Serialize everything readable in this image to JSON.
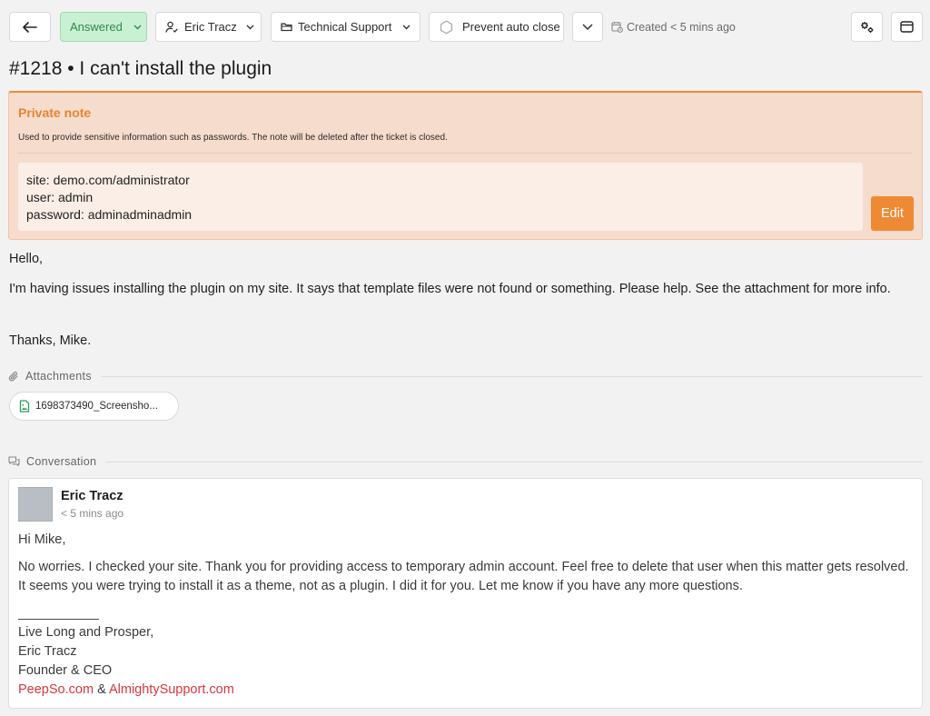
{
  "toolbar": {
    "status": "Answered",
    "agent": "Eric Tracz",
    "department": "Technical Support",
    "prevent_auto_close": "Prevent auto close",
    "created": "Created < 5 mins ago",
    "status_color": "#c9f0d3",
    "accent_color": "#ef8a34"
  },
  "ticket": {
    "title": "#1218 • I can't install the plugin"
  },
  "private_note": {
    "title": "Private note",
    "description": "Used to provide sensitive information such as passwords. The note will be deleted after the ticket is closed.",
    "lines": [
      "site: demo.com/administrator",
      "user: admin",
      "password: adminadminadmin"
    ],
    "edit_label": "Edit"
  },
  "message": {
    "paragraphs": [
      "Hello,",
      "I'm having issues installing the plugin on my site. It says that template files were not found or something. Please help. See the attachment for more info.",
      "Thanks, Mike."
    ]
  },
  "attachments": {
    "heading": "Attachments",
    "items": [
      {
        "name": "1698373490_Screensho..."
      }
    ]
  },
  "conversation": {
    "heading": "Conversation",
    "reply": {
      "author": "Eric Tracz",
      "time": "< 5 mins ago",
      "greeting": "Hi Mike,",
      "body": "No worries. I checked your site. Thank you for providing access to temporary admin account. Feel free to delete that user when this matter gets resolved. It seems you were trying to install it as a theme, not as a plugin. I did it for you. Let me know if you have any more questions.",
      "signature": {
        "line1": "Live Long and Prosper,",
        "line2": "Eric Tracz",
        "line3": "Founder & CEO",
        "link1": "PeepSo.com",
        "amp": "&",
        "link2": "AlmightySupport.com"
      }
    }
  }
}
